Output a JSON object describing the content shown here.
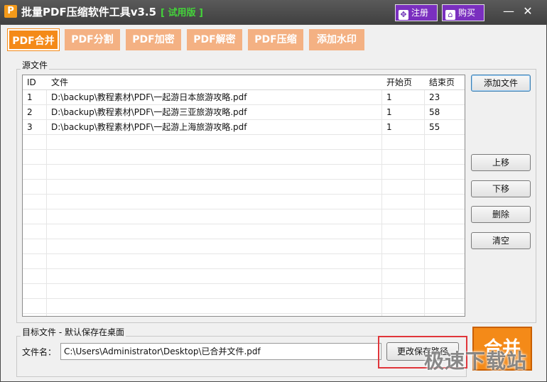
{
  "window": {
    "icon_letter": "P",
    "title": "批量PDF压缩软件工具v3.5",
    "trial_label": "[ 试用版 ]",
    "register_label": "注册",
    "buy_label": "购买",
    "minimize_glyph": "—",
    "close_glyph": "✕"
  },
  "tabs": [
    {
      "label": "PDF合并",
      "active": true
    },
    {
      "label": "PDF分割",
      "active": false
    },
    {
      "label": "PDF加密",
      "active": false
    },
    {
      "label": "PDF解密",
      "active": false
    },
    {
      "label": "PDF压缩",
      "active": false
    },
    {
      "label": "添加水印",
      "active": false
    }
  ],
  "source": {
    "group_label": "源文件",
    "columns": {
      "id": "ID",
      "file": "文件",
      "start": "开始页",
      "end": "结束页"
    },
    "rows": [
      {
        "id": "1",
        "file": "D:\\backup\\教程素材\\PDF\\一起游日本旅游攻略.pdf",
        "start": "1",
        "end": "23"
      },
      {
        "id": "2",
        "file": "D:\\backup\\教程素材\\PDF\\一起游三亚旅游攻略.pdf",
        "start": "1",
        "end": "58"
      },
      {
        "id": "3",
        "file": "D:\\backup\\教程素材\\PDF\\一起游上海旅游攻略.pdf",
        "start": "1",
        "end": "55"
      }
    ],
    "buttons": {
      "add": "添加文件",
      "up": "上移",
      "down": "下移",
      "delete": "删除",
      "clear": "清空"
    }
  },
  "target": {
    "group_label": "目标文件 - 默认保存在桌面",
    "filename_label": "文件名：",
    "filename_value": "C:\\Users\\Administrator\\Desktop\\已合并文件.pdf",
    "change_path_label": "更改保存路径",
    "merge_label": "合并"
  },
  "watermark_text": "极速下载站",
  "colors": {
    "accent": "#f48a18",
    "tab_inactive": "#f4b183",
    "purple": "#7a2fbf",
    "trial": "#44d43a",
    "highlight": "#e0353a"
  }
}
